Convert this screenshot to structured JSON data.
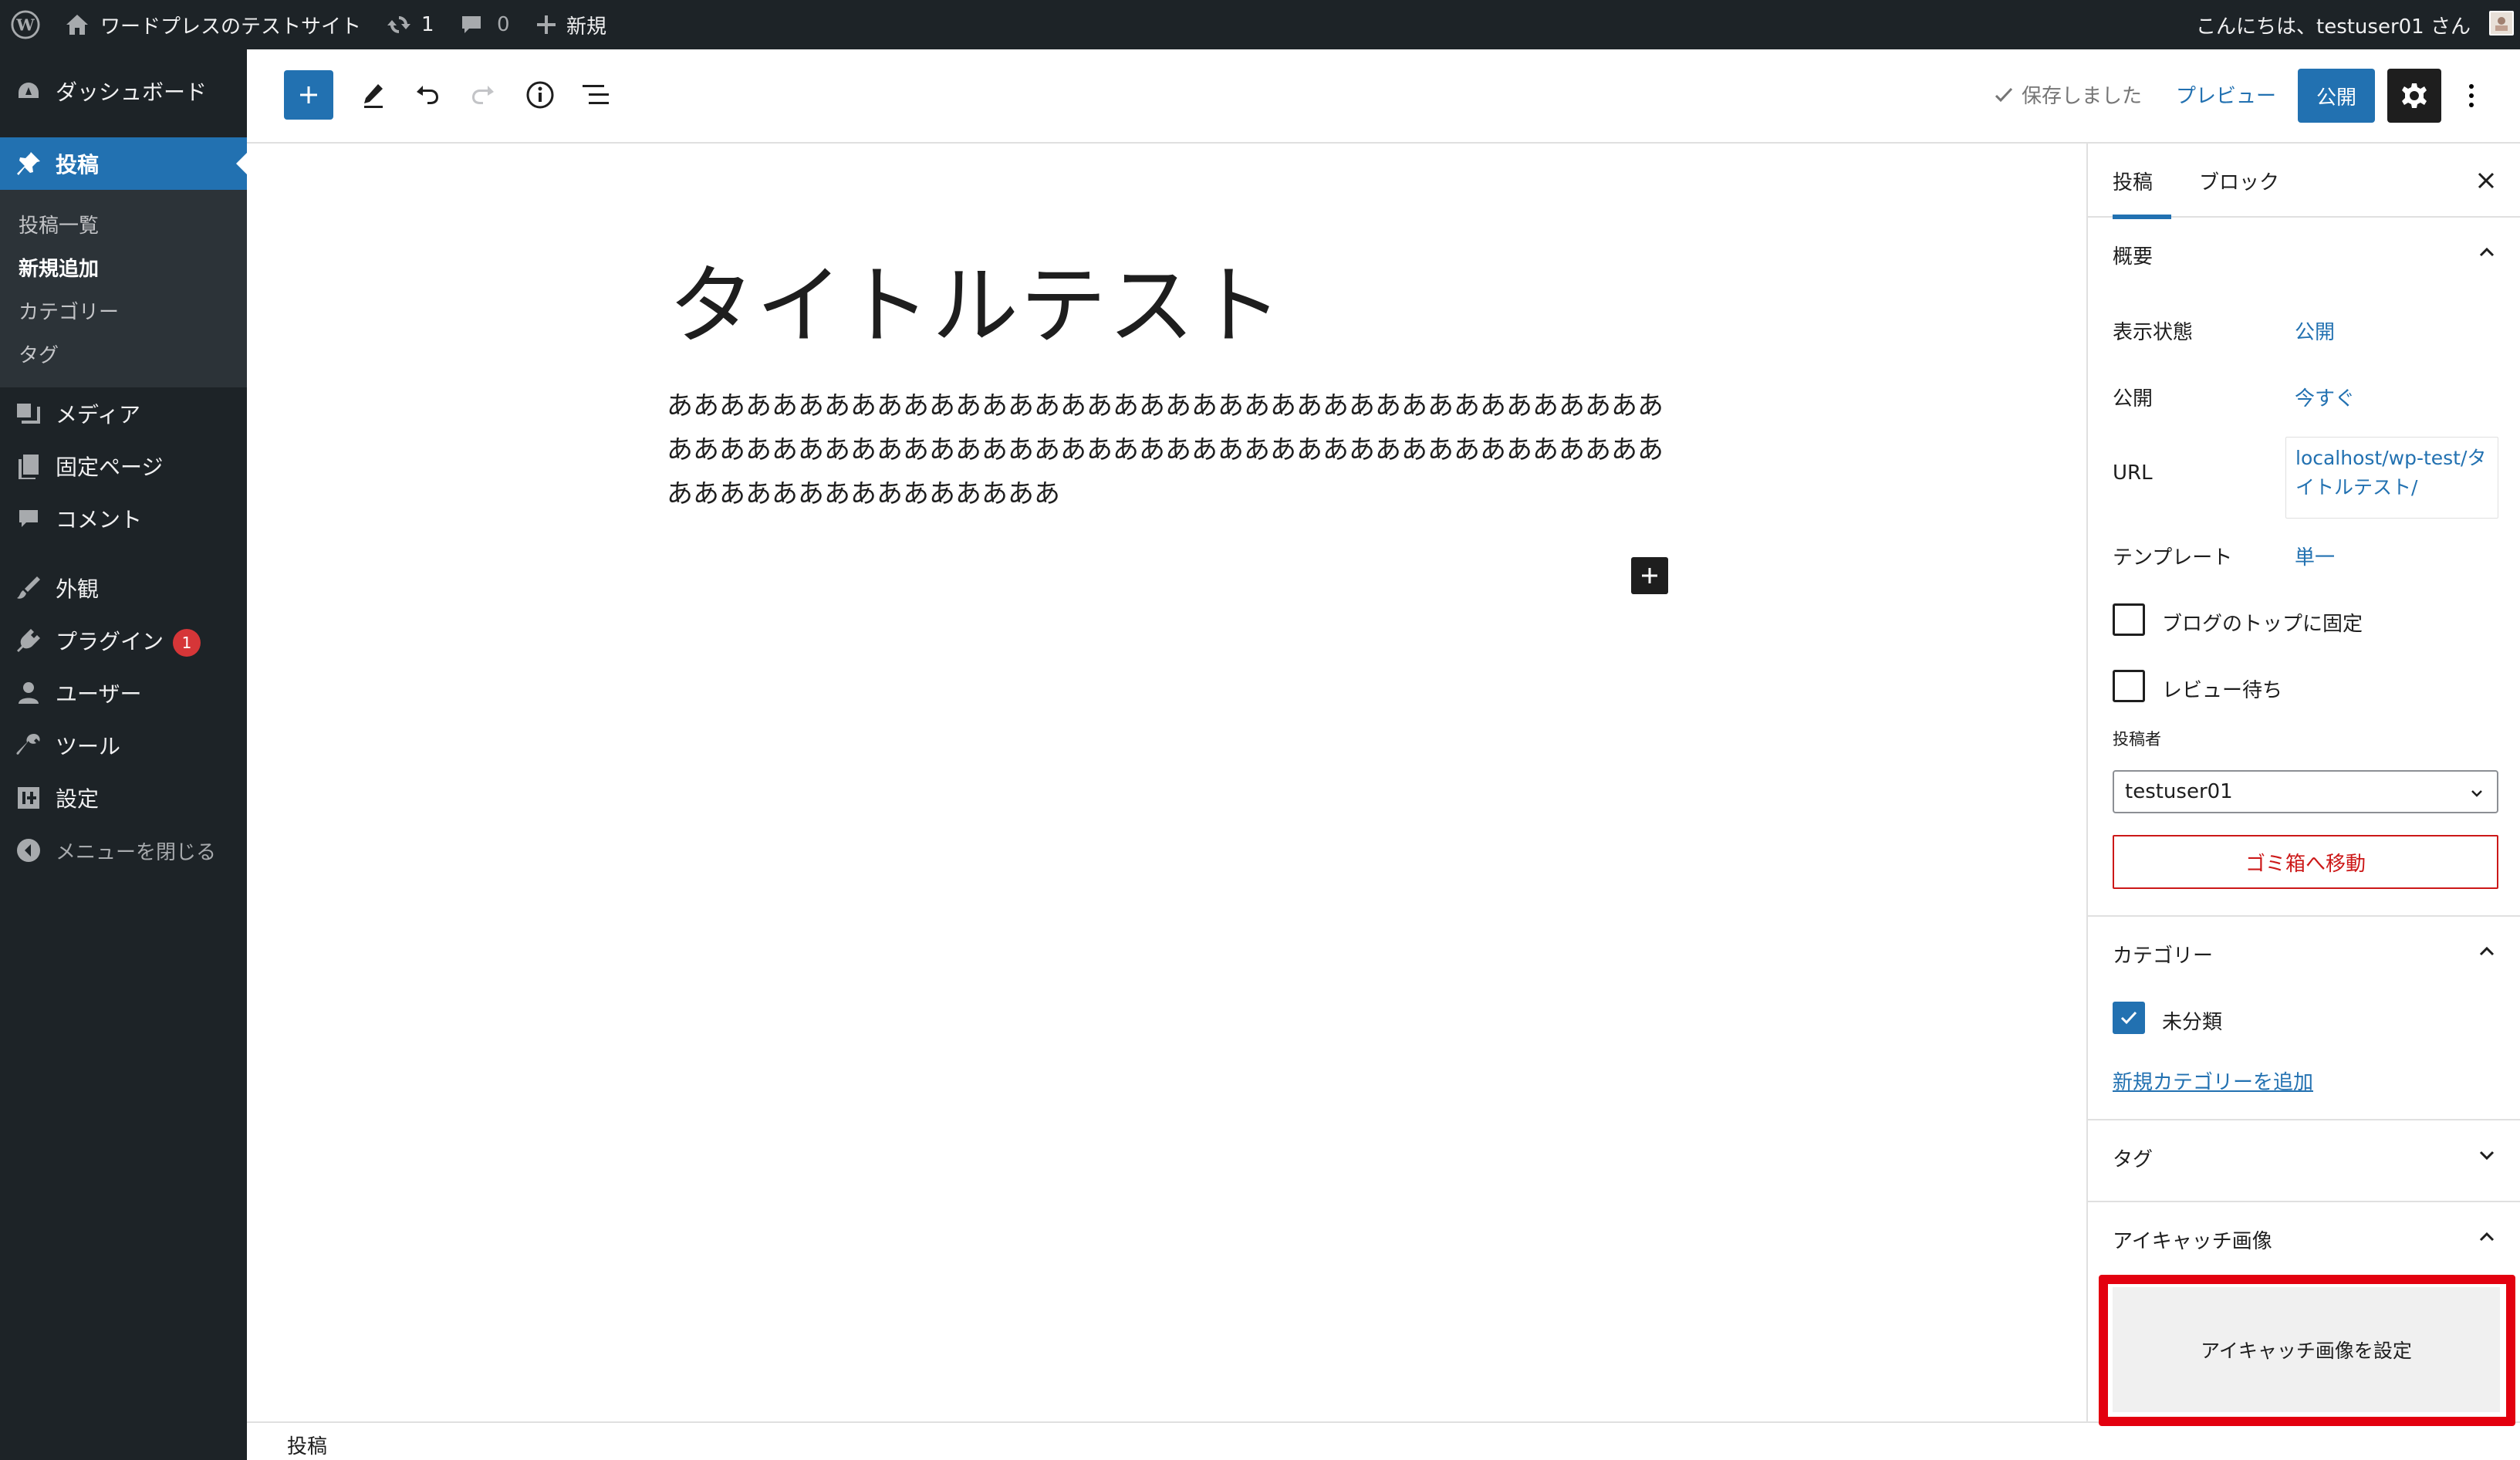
{
  "admin_bar": {
    "site_name": "ワードプレスのテストサイト",
    "updates_count": "1",
    "comments_count": "0",
    "new_label": "新規",
    "greeting": "こんにちは、testuser01 さん"
  },
  "sidebar": {
    "items": [
      {
        "label": "ダッシュボード",
        "icon": "dashboard-icon"
      },
      {
        "label": "投稿",
        "icon": "pin-icon"
      },
      {
        "label": "メディア",
        "icon": "media-icon"
      },
      {
        "label": "固定ページ",
        "icon": "page-icon"
      },
      {
        "label": "コメント",
        "icon": "comment-icon"
      },
      {
        "label": "外観",
        "icon": "appearance-icon"
      },
      {
        "label": "プラグイン",
        "icon": "plugin-icon",
        "badge": "1"
      },
      {
        "label": "ユーザー",
        "icon": "user-icon"
      },
      {
        "label": "ツール",
        "icon": "wrench-icon"
      },
      {
        "label": "設定",
        "icon": "settings-icon"
      }
    ],
    "submenu": [
      "投稿一覧",
      "新規追加",
      "カテゴリー",
      "タグ"
    ],
    "collapse_label": "メニューを閉じる"
  },
  "toolbar": {
    "saved_label": "保存しました",
    "preview_label": "プレビュー",
    "publish_label": "公開"
  },
  "editor": {
    "title": "タイトルテスト",
    "body": "あああああああああああああああああああああああああああああああああああああああああああああああああああああああああああああああああああああああああああああああああああああああああああ"
  },
  "footer": {
    "breadcrumb": "投稿"
  },
  "settings": {
    "tabs": [
      "投稿",
      "ブロック"
    ],
    "summary": {
      "title": "概要",
      "visibility_label": "表示状態",
      "visibility_value": "公開",
      "publish_label": "公開",
      "publish_value": "今すぐ",
      "url_label": "URL",
      "url_value": "localhost/wp-test/タイトルテスト/",
      "template_label": "テンプレート",
      "template_value": "単一",
      "sticky_label": "ブログのトップに固定",
      "pending_label": "レビュー待ち",
      "author_label": "投稿者",
      "author_value": "testuser01",
      "trash_label": "ゴミ箱へ移動"
    },
    "categories": {
      "title": "カテゴリー",
      "items": [
        {
          "label": "未分類",
          "checked": true
        }
      ],
      "add_link": "新規カテゴリーを追加"
    },
    "tags": {
      "title": "タグ"
    },
    "featured": {
      "title": "アイキャッチ画像",
      "button": "アイキャッチ画像を設定",
      "highlight_color": "#e3000f"
    }
  },
  "colors": {
    "accent": "#2271b1",
    "admin_bg": "#1d2327",
    "danger": "#cc1818"
  }
}
